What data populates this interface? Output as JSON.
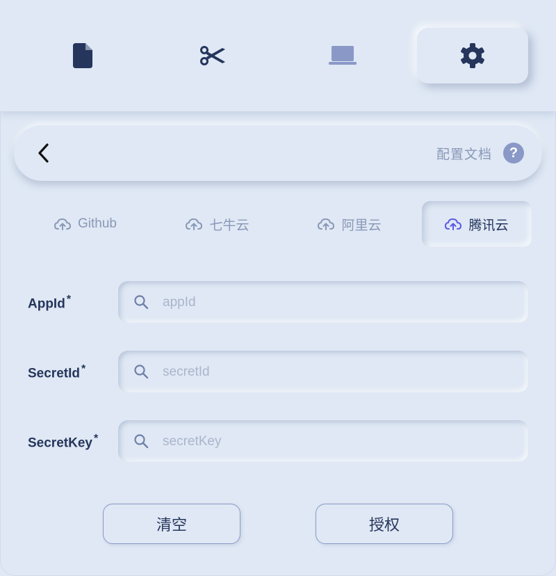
{
  "toolbar": {
    "items": [
      {
        "name": "file-icon",
        "active": false
      },
      {
        "name": "scissors-icon",
        "active": false
      },
      {
        "name": "laptop-icon",
        "active": false
      },
      {
        "name": "gear-icon",
        "active": true
      }
    ]
  },
  "header": {
    "doc_link": "配置文档",
    "help": "?"
  },
  "tabs": [
    {
      "label": "Github",
      "active": false
    },
    {
      "label": "七牛云",
      "active": false
    },
    {
      "label": "阿里云",
      "active": false
    },
    {
      "label": "腾讯云",
      "active": true
    }
  ],
  "form": {
    "fields": [
      {
        "label": "AppId",
        "required": "*",
        "placeholder": "appId",
        "value": ""
      },
      {
        "label": "SecretId",
        "required": "*",
        "placeholder": "secretId",
        "value": ""
      },
      {
        "label": "SecretKey",
        "required": "*",
        "placeholder": "secretKey",
        "value": ""
      }
    ]
  },
  "actions": {
    "clear": "清空",
    "authorize": "授权"
  },
  "colors": {
    "background": "#dfe8f4",
    "text_dark": "#25355c",
    "text_muted": "#8a98b8",
    "accent": "#5a5ae6"
  }
}
